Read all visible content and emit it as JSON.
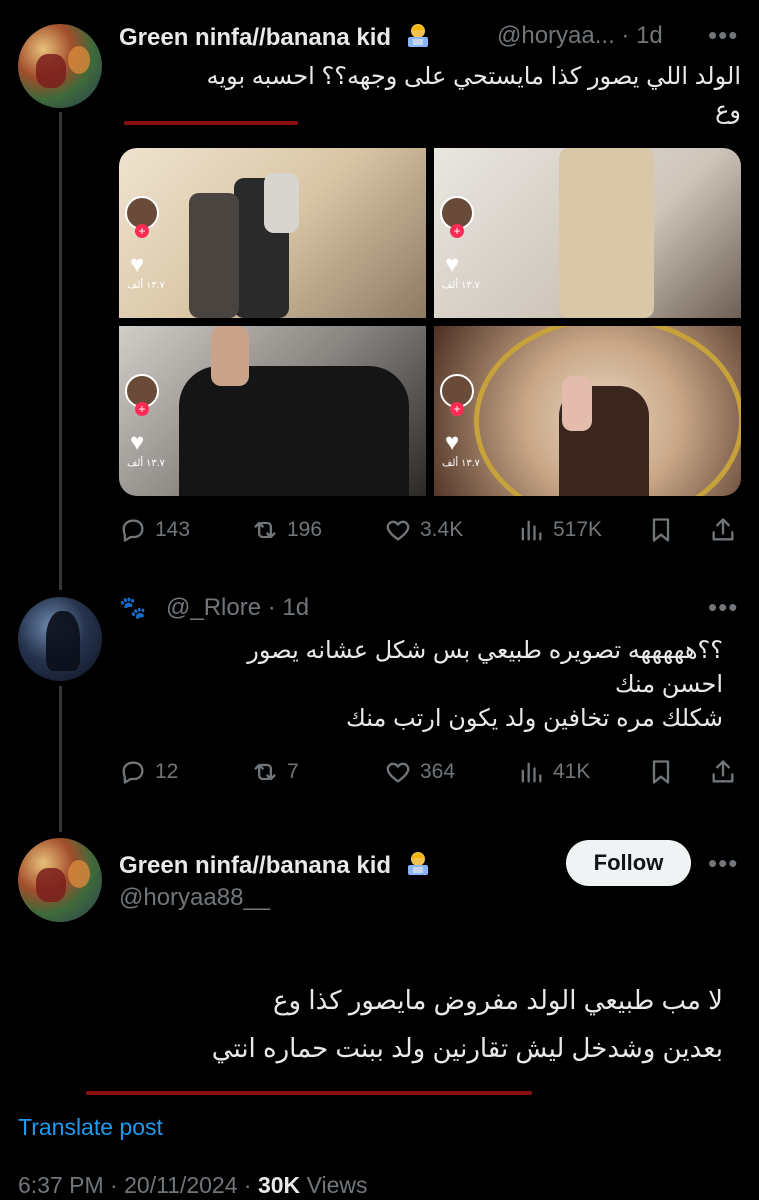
{
  "post1": {
    "name": "Green ninfa//banana kid",
    "handle": "@horyaa...",
    "time": "· 1d",
    "more": "•••",
    "text_line1": "الولد اللي يصور كذا مايستحي على وجهه؟؟ احسبه بويه",
    "text_line2": "وع",
    "media_side_count": "١٣.٧ ألف",
    "actions": {
      "replies": "143",
      "reposts": "196",
      "likes": "3.4K",
      "views": "517K"
    }
  },
  "post2": {
    "name_prefix": "🐾",
    "handle": "@_Rlore",
    "time": "· 1d",
    "more": "•••",
    "text_line1": "؟؟هههههه تصويره طبيعي بس شكل عشانه يصور",
    "text_line2": "احسن منك",
    "text_line3": "شكلك مره تخافين ولد يكون ارتب منك",
    "actions": {
      "replies": "12",
      "reposts": "7",
      "likes": "364",
      "views": "41K"
    }
  },
  "main_post": {
    "name": "Green ninfa//banana kid",
    "handle": "@horyaa88__",
    "follow_label": "Follow",
    "more": "•••",
    "text_line1": "لا مب طبيعي الولد مفروض مايصور كذا وع",
    "text_line2": "بعدين وشدخل ليش تقارنين ولد ببنت حماره انتي",
    "translate_label": "Translate post",
    "time": "6:37 PM",
    "date": "20/11/2024",
    "views_count": "30K",
    "views_label": "Views"
  },
  "colors": {
    "background": "#000000",
    "text_primary": "#e7e9ea",
    "text_secondary": "#71767b",
    "link": "#1d9bf0",
    "annotation_red": "#8b0f12"
  }
}
